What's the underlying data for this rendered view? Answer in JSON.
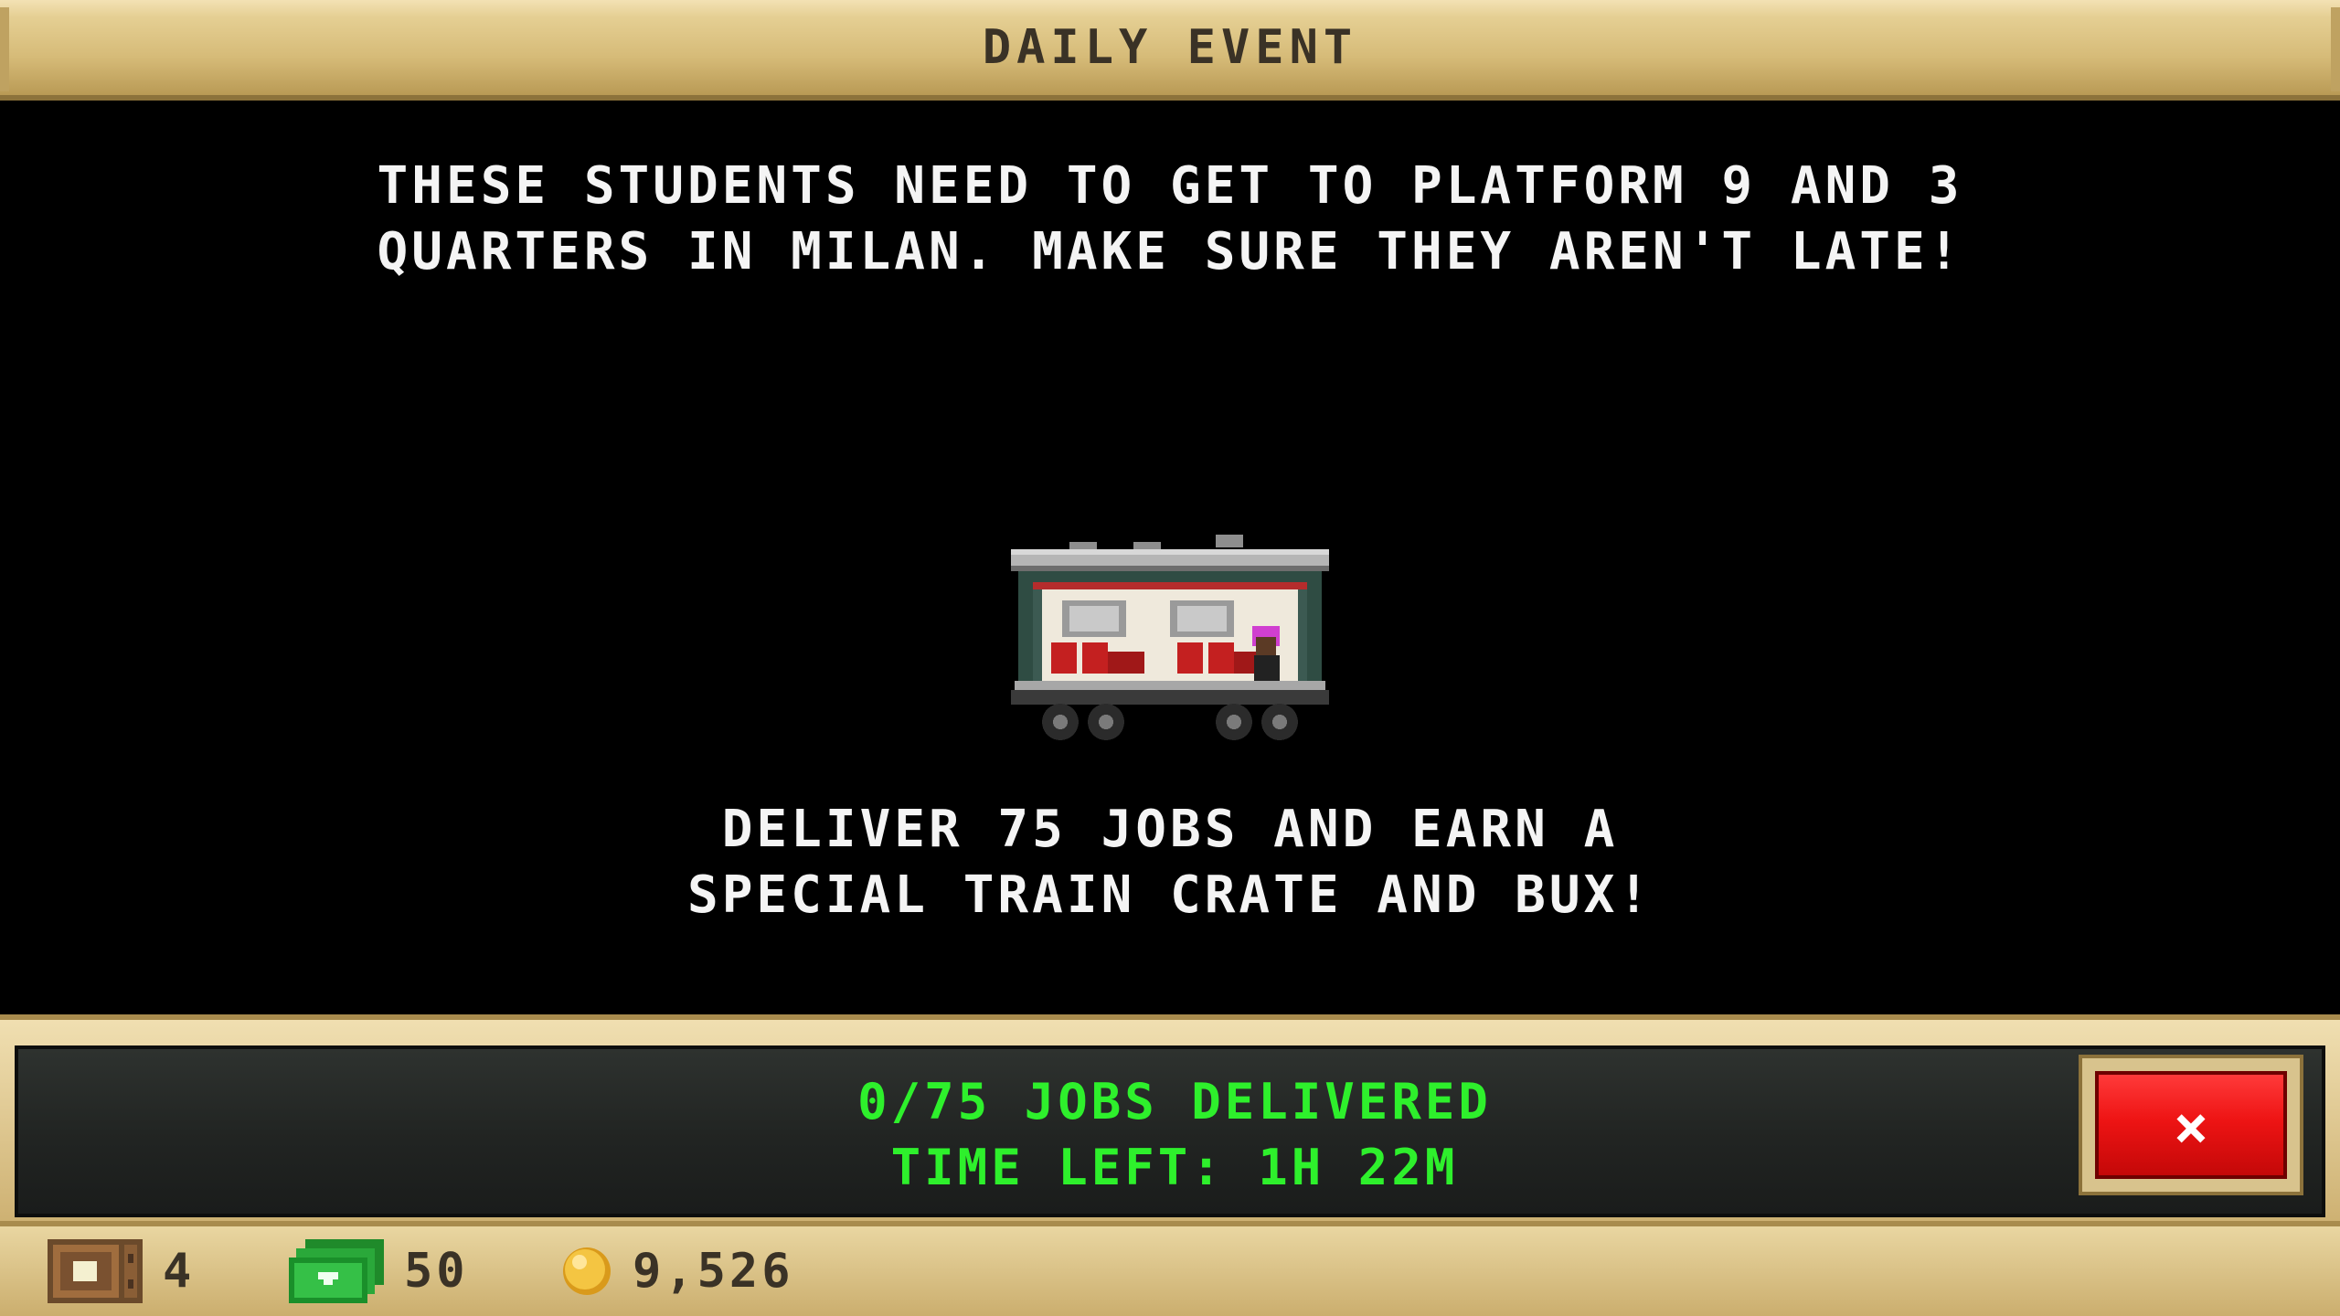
{
  "header": {
    "title": "DAILY EVENT"
  },
  "event": {
    "description_line1": "THESE STUDENTS NEED TO GET TO PLATFORM 9 AND 3",
    "description_line2": "QUARTERS IN MILAN. MAKE SURE THEY AREN'T LATE!",
    "goal_line1": "DELIVER 75 JOBS AND EARN A",
    "goal_line2": "SPECIAL TRAIN CRATE AND BUX!"
  },
  "progress": {
    "jobs_text": "0/75 JOBS DELIVERED",
    "time_text": "TIME LEFT: 1H 22M",
    "text_color": "#2ef02c"
  },
  "close_button": {
    "glyph": "×",
    "color": "#ee1414"
  },
  "status": {
    "crates": {
      "icon": "crate-icon",
      "value": "4"
    },
    "bux": {
      "icon": "bux-cash-icon",
      "value": "50"
    },
    "coins": {
      "icon": "gold-coin-icon",
      "value": "9,526"
    }
  }
}
